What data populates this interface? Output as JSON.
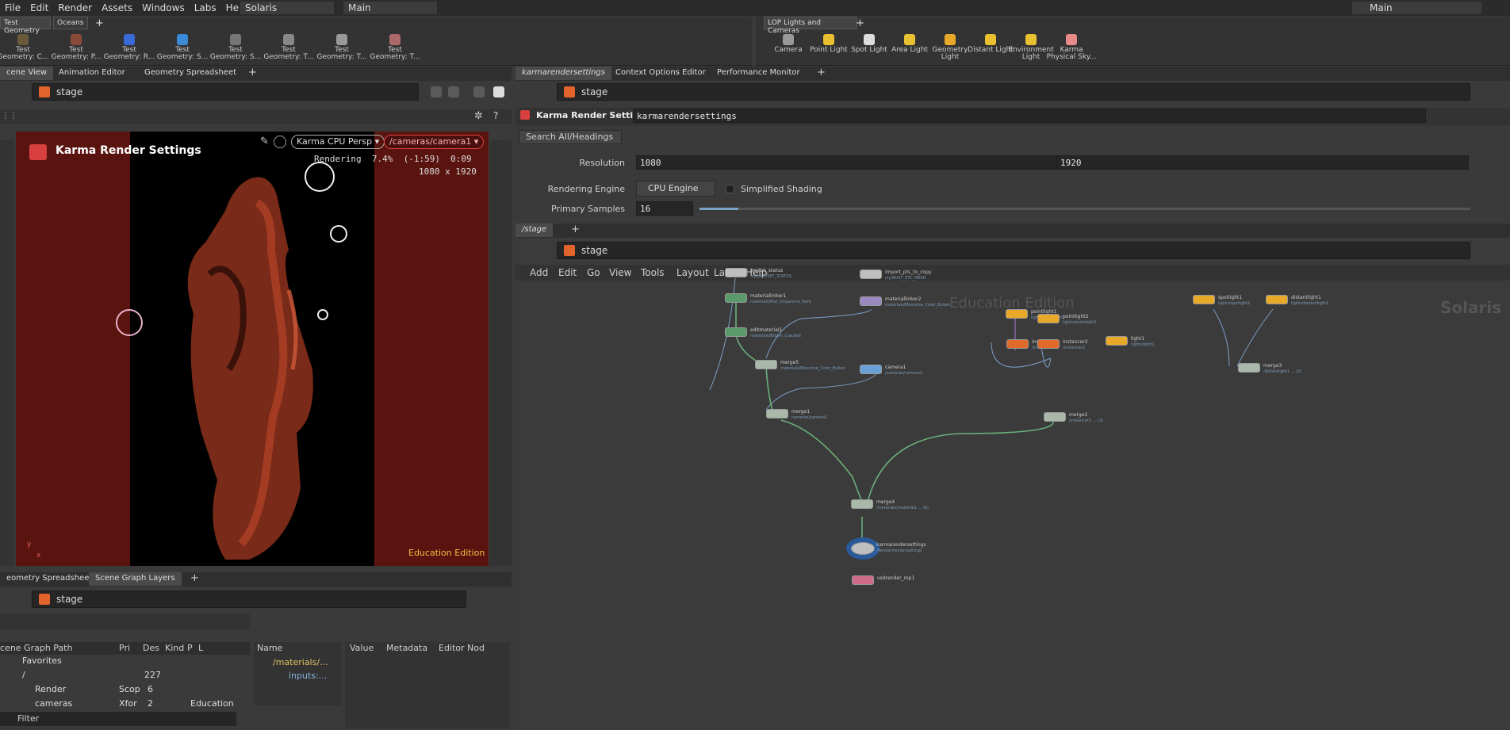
{
  "menu": {
    "items": [
      "File",
      "Edit",
      "Render",
      "Assets",
      "Windows",
      "Labs",
      "Help"
    ],
    "desktop": "Solaris",
    "context": "Main",
    "right_context": "Main"
  },
  "shelf_left": {
    "tabs": [
      "Test Geometry",
      "Oceans"
    ],
    "tools": [
      {
        "l1": "Test",
        "l2": "Geometry: C..."
      },
      {
        "l1": "Test",
        "l2": "Geometry: P..."
      },
      {
        "l1": "Test",
        "l2": "Geometry: R..."
      },
      {
        "l1": "Test",
        "l2": "Geometry: S..."
      },
      {
        "l1": "Test",
        "l2": "Geometry: S..."
      },
      {
        "l1": "Test",
        "l2": "Geometry: T..."
      },
      {
        "l1": "Test",
        "l2": "Geometry: T..."
      },
      {
        "l1": "Test",
        "l2": "Geometry: T..."
      }
    ]
  },
  "shelf_right": {
    "tabs": [
      "LOP Lights and Cameras"
    ],
    "tools": [
      {
        "l1": "Camera",
        "l2": ""
      },
      {
        "l1": "Point Light",
        "l2": ""
      },
      {
        "l1": "Spot Light",
        "l2": ""
      },
      {
        "l1": "Area Light",
        "l2": ""
      },
      {
        "l1": "Geometry",
        "l2": "Light"
      },
      {
        "l1": "Distant Light",
        "l2": ""
      },
      {
        "l1": "Environment",
        "l2": "Light"
      },
      {
        "l1": "Karma",
        "l2": "Physical Sky..."
      }
    ]
  },
  "viewer": {
    "tabs": [
      "cene View",
      "Animation Editor",
      "Geometry Spreadsheet"
    ],
    "path": "stage",
    "title": "Karma Render Settings",
    "renderer": "Karma CPU  Persp",
    "camera": "/cameras/camera1",
    "status": "Rendering  7.4%  (-1:59)  0:09",
    "resolution": "1080 x 1920",
    "watermark": "Education Edition",
    "axis_y": "y",
    "axis_x": "x"
  },
  "params": {
    "tabs": [
      "karmarendersettings",
      "Context Options Editor",
      "Performance Monitor"
    ],
    "path": "stage",
    "node_type": "Karma Render Settings",
    "node_name": "karmarendersettings",
    "search": "Search All/Headings",
    "resolution_label": "Resolution",
    "res_w": "1080",
    "res_h": "1920",
    "engine_label": "Rendering Engine",
    "engine": "CPU Engine",
    "simplified": "Simplified Shading",
    "samples_label": "Primary Samples",
    "samples": "16",
    "samples_fraction": 0.05
  },
  "network": {
    "tab": "/stage",
    "path": "stage",
    "menu": [
      "Add",
      "Edit",
      "Go",
      "View",
      "Tools",
      "Layout",
      "Labs",
      "Help"
    ],
    "watermark": "Education Edition",
    "context_label": "Solaris",
    "nodes": [
      {
        "name": "import_status",
        "sub": "/xy/port/SET_STATUS",
        "color": "#bfbfbf"
      },
      {
        "name": "materiallinker1",
        "sub": "materials/Mat_Grapevine_Bark",
        "color": "#5a9a6a"
      },
      {
        "name": "editmaterial1",
        "sub": "materials/Brown_Cracked",
        "color": "#5a9a6a"
      },
      {
        "name": "merge5",
        "sub": "materials/Moonrise_Color_Bolten",
        "color": "#a9b8a9"
      },
      {
        "name": "merge1",
        "sub": "cameras/camera1",
        "color": "#a9b8a9"
      },
      {
        "name": "camera1",
        "sub": "/cameras/camera1",
        "color": "#6aa0d8"
      },
      {
        "name": "import_pts_to_copy",
        "sub": "/xy/BUST_ETC_MESH",
        "color": "#bfbfbf"
      },
      {
        "name": "materiallinker2",
        "sub": "materials/Moonrise_Color_Bolten",
        "color": "#9a88c0"
      },
      {
        "name": "pointlight1",
        "sub": "lights/pointlight1",
        "color": "#e8a828"
      },
      {
        "name": "pointlight2",
        "sub": "lights/pointlight2",
        "color": "#e8a828"
      },
      {
        "name": "instancer1",
        "sub": "/instancer1",
        "color": "#e06a2a"
      },
      {
        "name": "instancer2",
        "sub": "/instancer2",
        "color": "#e06a2a"
      },
      {
        "name": "light1",
        "sub": "lights/light1",
        "color": "#e8a828"
      },
      {
        "name": "merge2",
        "sub": "/instancer1 ... (3)",
        "color": "#a9b8a9"
      },
      {
        "name": "spotlight1",
        "sub": "lights/spotlight1",
        "color": "#e8a828"
      },
      {
        "name": "distantlight1",
        "sub": "lights/distantlight1",
        "color": "#e8a828"
      },
      {
        "name": "merge3",
        "sub": "/distantlight1 ... (2)",
        "color": "#a9b8a9"
      },
      {
        "name": "merge4",
        "sub": "/materials/material1 ... (8)",
        "color": "#a9b8a9"
      },
      {
        "name": "karmarendersettings",
        "sub": "/Render/rendersettings",
        "color": "#bfbfbf"
      },
      {
        "name": "usdrender_rop1",
        "sub": "",
        "color": "#d06a8a"
      }
    ]
  },
  "scenegraph": {
    "tabs": [
      "eometry Spreadsheet",
      "Scene Graph Layers"
    ],
    "path": "stage",
    "cols": [
      "cene Graph Path",
      "Pri",
      "Des",
      "Kind",
      "P",
      "L"
    ],
    "rows": [
      {
        "name": "Favorites",
        "pri": "",
        "des": "",
        "kind": ""
      },
      {
        "name": "/",
        "pri": "",
        "des": "227",
        "kind": ""
      },
      {
        "name": "Render",
        "pri": "Scop",
        "des": "6",
        "kind": ""
      },
      {
        "name": "cameras",
        "pri": "Xfor",
        "des": "2",
        "kind": "Education"
      }
    ],
    "filter": "Filter",
    "inspector_cols": [
      "Name",
      "Value",
      "Metadata",
      "Editor Nod"
    ],
    "inspector_rows": [
      "/materials/...",
      "inputs:..."
    ]
  }
}
